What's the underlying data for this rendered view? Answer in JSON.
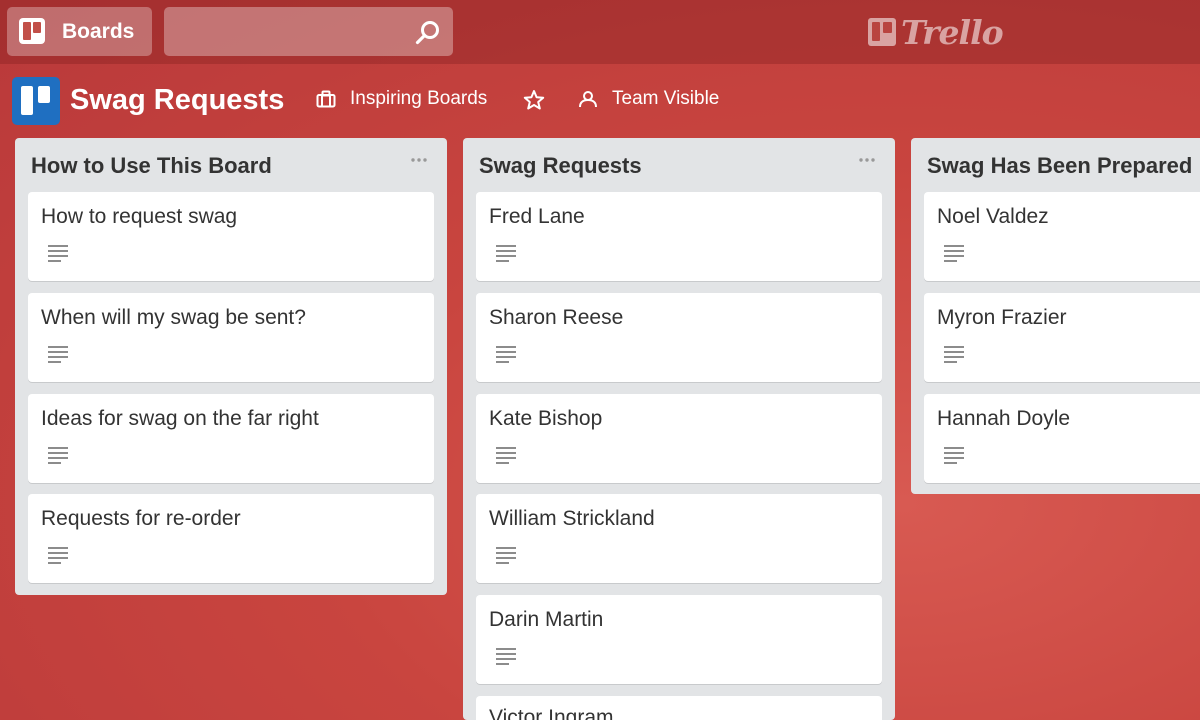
{
  "header": {
    "boards_label": "Boards",
    "search_placeholder": "",
    "logo_text": "Trello"
  },
  "board": {
    "title": "Swag Requests",
    "team_label": "Inspiring Boards",
    "visibility_label": "Team Visible"
  },
  "colors": {
    "background": "#c9453f",
    "board_logo": "#1f6fc1",
    "list_bg": "#e2e4e6"
  },
  "lists": [
    {
      "title": "How to Use This Board",
      "cards": [
        "How to request swag",
        "When will my swag be sent?",
        "Ideas for swag on the far right",
        "Requests for re-order"
      ]
    },
    {
      "title": "Swag Requests",
      "cards": [
        "Fred Lane",
        "Sharon Reese",
        "Kate Bishop",
        "William Strickland",
        "Darin Martin",
        "Victor Ingram"
      ]
    },
    {
      "title": "Swag Has Been Prepared",
      "cards": [
        "Noel Valdez",
        "Myron Frazier",
        "Hannah Doyle"
      ]
    }
  ]
}
